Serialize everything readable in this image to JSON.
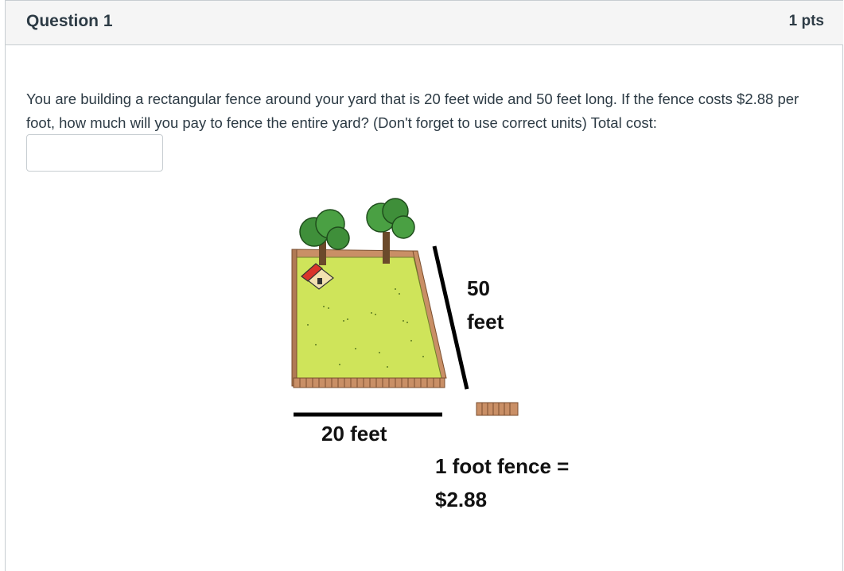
{
  "question": {
    "title": "Question 1",
    "points": "1 pts",
    "text": "You are building a rectangular fence around your yard that is 20 feet wide and 50 feet long. If the fence costs $2.88 per foot, how much will you pay to fence the entire yard? (Don't forget to use correct units) Total cost:",
    "answer": {
      "value": "",
      "placeholder": ""
    }
  },
  "figure": {
    "length_label_line1": "50",
    "length_label_line2": "feet",
    "width_label": "20 feet",
    "price_label_line1": "1 foot fence =",
    "price_label_line2": "$2.88"
  },
  "colors": {
    "header_bg": "#f5f5f5",
    "text": "#2d3b45",
    "border": "#c7cdd1",
    "lawn": "#cfe45a",
    "fence": "#b07a55",
    "tree": "#3f8f3a",
    "roof": "#d9342b"
  }
}
